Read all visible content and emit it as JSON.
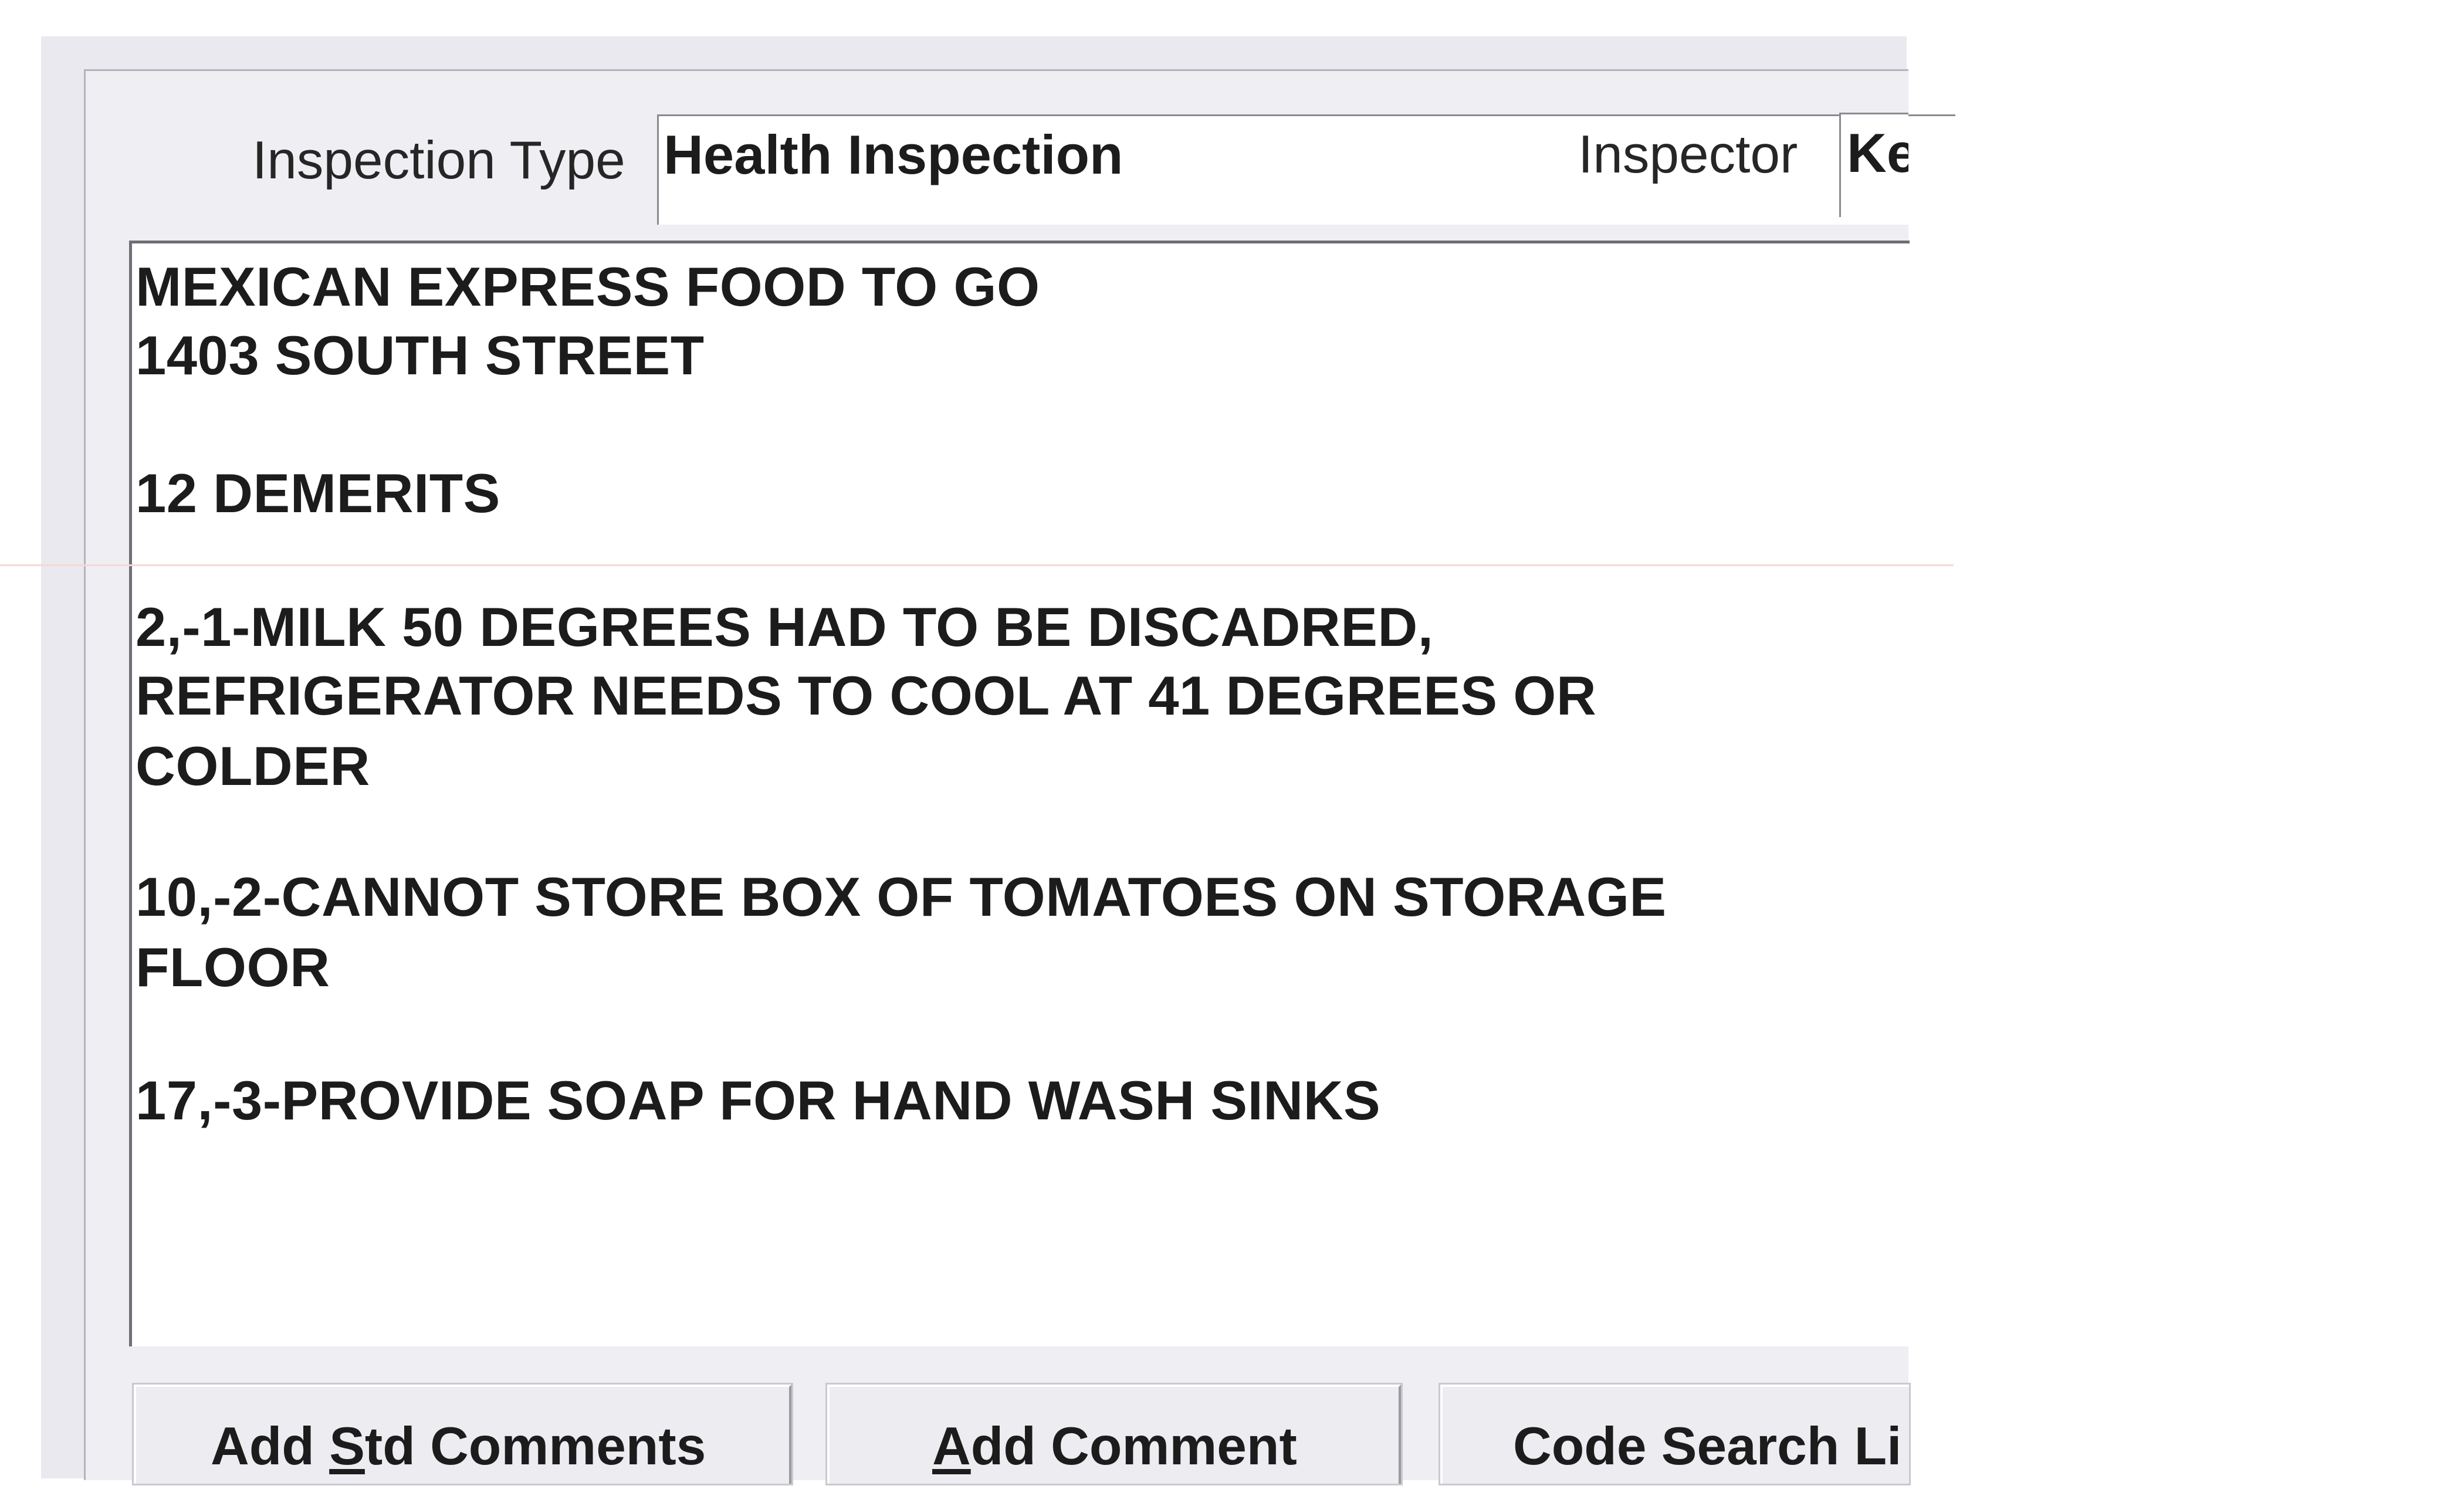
{
  "header": {
    "inspection_type_label": "Inspection Type",
    "inspection_type_value": "Health Inspection",
    "inspector_label": "Inspector",
    "inspector_value": "Ke"
  },
  "comments": {
    "lines": [
      "MEXICAN EXPRESS FOOD TO GO",
      "1403 SOUTH STREET",
      "12 DEMERITS",
      "2,-1-MILK 50 DEGREES HAD TO BE DISCADRED,",
      "REFRIGERATOR NEEDS TO COOL AT 41 DEGREES OR",
      "COLDER",
      "10,-2-CANNOT STORE BOX OF TOMATOES ON STORAGE",
      "FLOOR",
      "17,-3-PROVIDE SOAP FOR HAND WASH SINKS"
    ]
  },
  "buttons": {
    "add_std_comments": {
      "pre": "Add ",
      "accel": "S",
      "post": "td Comments"
    },
    "add_comment": {
      "pre": "",
      "accel": "A",
      "post": "dd Comment"
    },
    "code_search": {
      "pre": "Code Search Li",
      "accel": "",
      "post": ""
    }
  }
}
